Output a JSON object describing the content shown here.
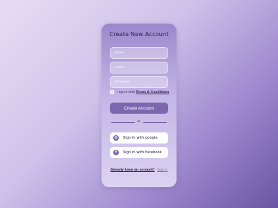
{
  "form": {
    "title": "Create New Account",
    "name_placeholder": "Name",
    "email_placeholder": "Email",
    "password_placeholder": "Password",
    "terms_prefix": "I agree with",
    "terms_link": "Terms & Conditions",
    "terms_checked": false,
    "create_label": "Create Account",
    "divider_text": "or",
    "google_label": "Sign in with google",
    "google_icon": "G",
    "facebook_label": "Sign in with facebook",
    "facebook_icon": "f",
    "signin_question": "Already have an account?",
    "signin_link": "Sign in"
  },
  "colors": {
    "accent": "#7c66ad",
    "title_text": "#2b1f47",
    "card_top": "#9b87cc",
    "card_bottom": "#dcd3f1"
  }
}
